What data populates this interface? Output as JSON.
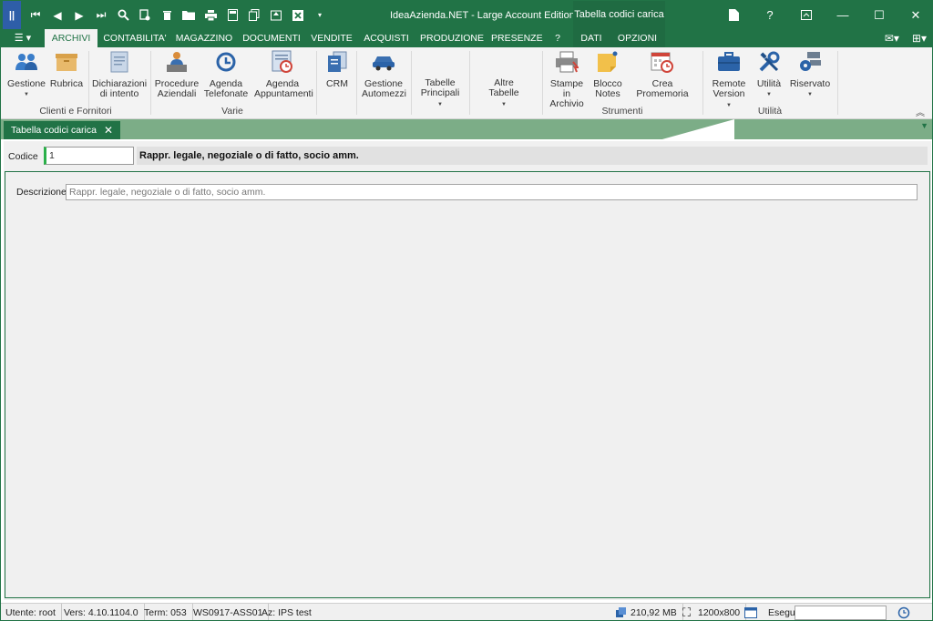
{
  "window": {
    "title": "IdeaAzienda.NET - Large Account Edition",
    "context_title": "Tabella codici carica",
    "controls": {
      "help": "?",
      "minimize": "—",
      "maximize": "☐",
      "close": "✕"
    }
  },
  "ribbon_tabs": [
    {
      "label": "ARCHIVI",
      "active": true
    },
    {
      "label": "CONTABILITA'"
    },
    {
      "label": "MAGAZZINO"
    },
    {
      "label": "DOCUMENTI"
    },
    {
      "label": "VENDITE"
    },
    {
      "label": "ACQUISTI"
    },
    {
      "label": "PRODUZIONE"
    },
    {
      "label": "PRESENZE"
    },
    {
      "label": "?"
    },
    {
      "label": "DATI"
    },
    {
      "label": "OPZIONI"
    }
  ],
  "ribbon": {
    "buttons": {
      "gestione": "Gestione",
      "rubrica": "Rubrica",
      "dichiarazioni": "Dichiarazioni\ndi intento",
      "procedure": "Procedure\nAziendali",
      "agenda_tel": "Agenda\nTelefonate",
      "agenda_app": "Agenda\nAppuntamenti",
      "crm": "CRM",
      "automezzi": "Gestione\nAutomezzi",
      "tabelle": "Tabelle\nPrincipali",
      "altre": "Altre\nTabelle",
      "stampe": "Stampe in\nArchivio",
      "blocco": "Blocco\nNotes",
      "promemoria": "Crea Promemoria",
      "remote": "Remote\nVersion",
      "utilita_btn": "Utilità",
      "riservato": "Riservato"
    },
    "groups": {
      "clienti": "Clienti e Fornitori",
      "varie": "Varie",
      "strumenti": "Strumenti",
      "utilita": "Utilità"
    }
  },
  "doc_tab": {
    "label": "Tabella codici carica"
  },
  "form": {
    "codice_label": "Codice",
    "codice_value": "1",
    "codice_description": "Rappr. legale, negoziale o di fatto, socio amm.",
    "descrizione_label": "Descrizione",
    "descrizione_value": "Rappr. legale, negoziale o di fatto, socio amm."
  },
  "status": {
    "user": "Utente: root",
    "version": "Vers: 4.10.1104.0",
    "terminal": "Term: 053",
    "workstation": "WS0917-ASS01",
    "company": "Az: IPS test",
    "memory": "210,92 MB",
    "resolution": "1200x800",
    "esegui_label": "Esegui"
  },
  "colors": {
    "accent": "#217346",
    "strip": "#7cad87",
    "app_icon": "#2e5ea8"
  }
}
